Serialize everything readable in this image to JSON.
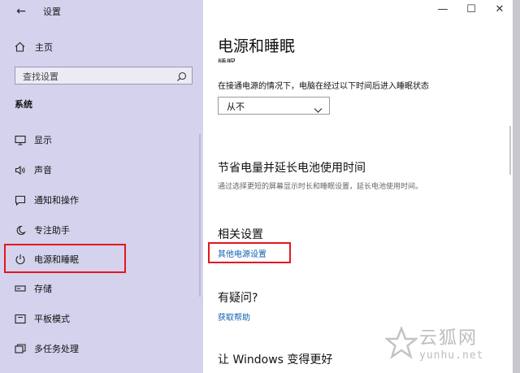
{
  "app": {
    "title": "设置"
  },
  "sidebar": {
    "home_label": "主页",
    "search_placeholder": "查找设置",
    "section": "系统",
    "items": [
      {
        "label": "显示",
        "icon": "monitor-icon"
      },
      {
        "label": "声音",
        "icon": "speaker-icon"
      },
      {
        "label": "通知和操作",
        "icon": "message-icon"
      },
      {
        "label": "专注助手",
        "icon": "moon-icon"
      },
      {
        "label": "电源和睡眠",
        "icon": "power-icon",
        "selected": true
      },
      {
        "label": "存储",
        "icon": "storage-icon"
      },
      {
        "label": "平板模式",
        "icon": "tablet-icon"
      },
      {
        "label": "多任务处理",
        "icon": "multitask-icon"
      }
    ]
  },
  "main": {
    "title": "电源和睡眠",
    "subtitle_cut": "睡眠",
    "sleep_desc": "在接通电源的情况下，电脑在经过以下时间后进入睡眠状态",
    "sleep_value": "从不",
    "save_heading": "节省电量并延长电池使用时间",
    "save_desc": "通过选择更短的屏幕显示时长和睡眠设置，延长电池使用时间。",
    "related_heading": "相关设置",
    "related_link": "其他电源设置",
    "question_heading": "有疑问?",
    "help_link": "获取帮助",
    "windows_heading": "让 Windows 变得更好"
  },
  "watermark": {
    "text": "云狐网",
    "url": "yunhu.net"
  },
  "colors": {
    "sidebar_bg": "#d4d2ec",
    "highlight": "#e3161f",
    "link": "#1060b0"
  }
}
